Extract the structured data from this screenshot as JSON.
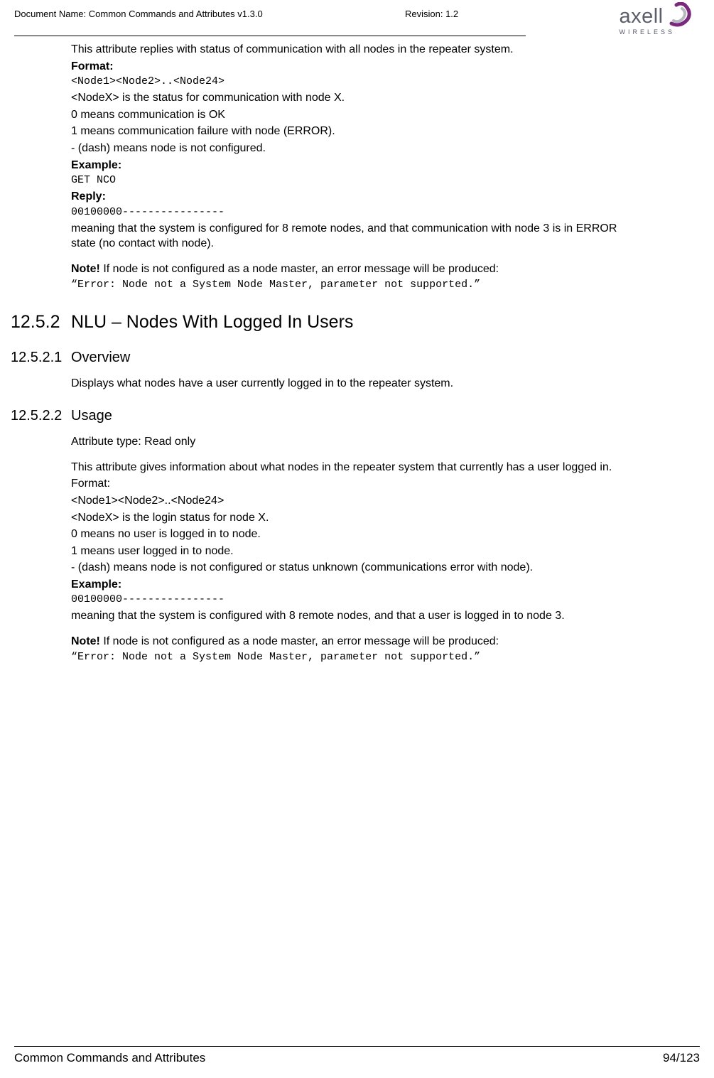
{
  "header": {
    "docName": "Document Name: Common Commands and Attributes v1.3.0",
    "revision": "Revision: 1.2",
    "logoText": "axell",
    "logoSub": "WIRELESS"
  },
  "body": {
    "p1": "This attribute replies with status of communication with all nodes in the repeater system.",
    "formatLabel": "Format:",
    "formatCode": "<Node1><Node2>..<Node24>",
    "p2a": "<NodeX> is the status for communication with node X.",
    "p2b": "0 means communication is OK",
    "p2c": "1 means communication failure with node (ERROR).",
    "p2d": "- (dash) means node is not configured.",
    "exampleLabel": "Example:",
    "exampleCode": "GET NCO",
    "replyLabel": "Reply:",
    "replyCode": "00100000----------------",
    "p3": "meaning that the system is configured for 8 remote nodes, and that communication with node 3 is in ERROR state (no contact with node).",
    "noteBold": "Note!",
    "noteText": " If node is not configured as a node master, an error message will be produced:",
    "noteCode": "“Error: Node not a System Node Master, parameter not supported.”"
  },
  "sec1252": {
    "num": "12.5.2",
    "title": "NLU – Nodes With Logged In Users"
  },
  "sec12521": {
    "num": "12.5.2.1",
    "title": "Overview",
    "p1": "Displays what nodes have a user currently logged in to the repeater system."
  },
  "sec12522": {
    "num": "12.5.2.2",
    "title": "Usage",
    "p1": "Attribute type: Read only",
    "p2": "This attribute gives information about what nodes in the repeater system that currently has a user logged in.",
    "p3": "Format:",
    "p4": "<Node1><Node2>..<Node24>",
    "p5": "<NodeX> is the login status for node X.",
    "p6": "0 means no user is logged in to node.",
    "p7": "1 means user logged in to node.",
    "p8": "- (dash) means node is not configured or status unknown (communications error with node).",
    "exampleLabel": "Example:",
    "exampleCode": "00100000----------------",
    "p9": "meaning that the system is configured with 8 remote nodes, and that a user is logged in to node 3.",
    "noteBold": "Note!",
    "noteText": " If node is not configured as a node master, an error message will be produced:",
    "noteCode": "“Error: Node not a System Node Master, parameter not supported.”"
  },
  "footer": {
    "left": "Common Commands and Attributes",
    "right": "94/123"
  }
}
